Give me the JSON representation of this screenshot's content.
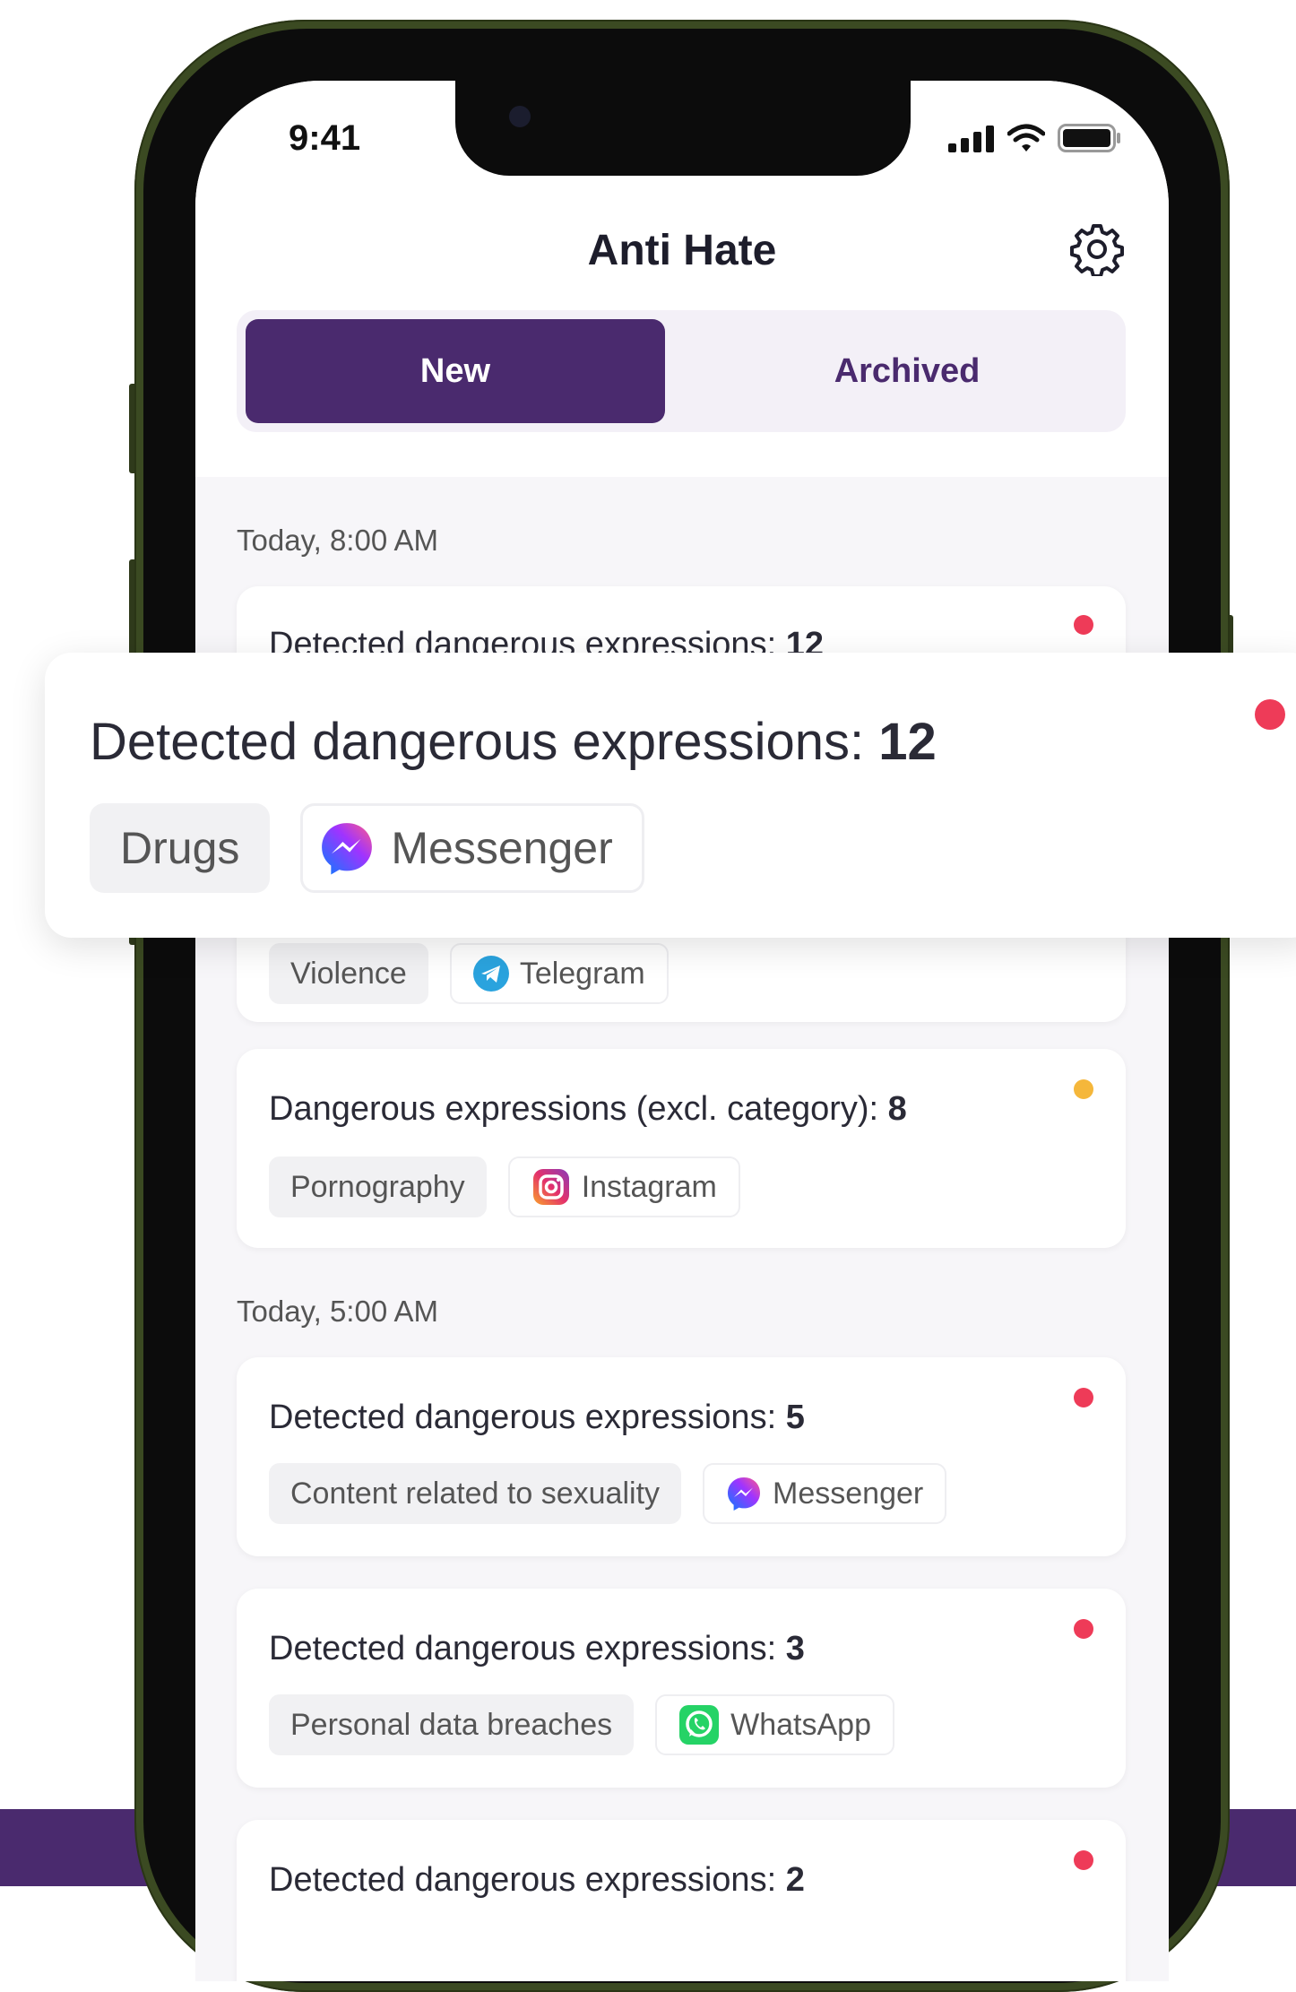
{
  "status_bar": {
    "time": "9:41"
  },
  "header": {
    "title": "Anti Hate"
  },
  "tabs": [
    {
      "label": "New",
      "selected": true
    },
    {
      "label": "Archived",
      "selected": false
    }
  ],
  "sections": [
    {
      "label": "Today, 8:00 AM"
    },
    {
      "label": "Today, 5:00 AM"
    }
  ],
  "cards": [
    {
      "title": "Detected dangerous expressions:",
      "count": "12",
      "category": "Violence",
      "app": "Telegram",
      "app_icon": "telegram-icon",
      "dot_color": "#ee3b58"
    },
    {
      "title": "Dangerous expressions (excl. category):",
      "count": "8",
      "category": "Pornography",
      "app": "Instagram",
      "app_icon": "instagram-icon",
      "dot_color": "#f5b73b"
    },
    {
      "title": "Detected dangerous expressions:",
      "count": "5",
      "category": "Content related to sexuality",
      "app": "Messenger",
      "app_icon": "messenger-icon",
      "dot_color": "#ee3b58"
    },
    {
      "title": "Detected dangerous expressions:",
      "count": "3",
      "category": "Personal data breaches",
      "app": "WhatsApp",
      "app_icon": "whatsapp-icon",
      "dot_color": "#ee3b58"
    },
    {
      "title": "Detected dangerous expressions:",
      "count": "2",
      "dot_color": "#ee3b58"
    }
  ],
  "overlay_card": {
    "title": "Detected dangerous expressions:",
    "count": "12",
    "category": "Drugs",
    "app": "Messenger",
    "app_icon": "messenger-icon",
    "dot_color": "#ee3b58"
  },
  "colors": {
    "accent": "#4a2a6e",
    "alert_red": "#ee3b58",
    "alert_yellow": "#f5b73b"
  }
}
